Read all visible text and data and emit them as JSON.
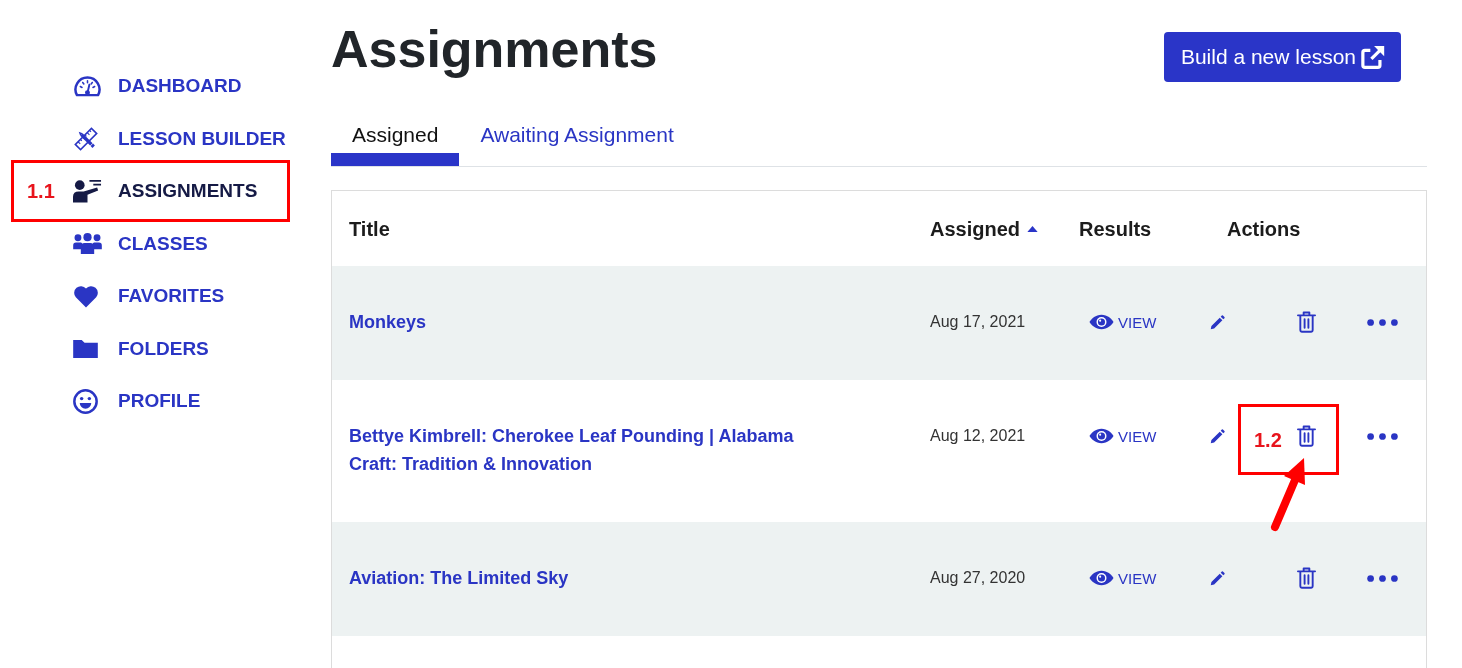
{
  "sidebar": {
    "items": [
      {
        "label": "DASHBOARD",
        "selected": false
      },
      {
        "label": "LESSON BUILDER",
        "selected": false
      },
      {
        "label": "ASSIGNMENTS",
        "selected": true,
        "annotation": {
          "label": "1.1"
        }
      },
      {
        "label": "CLASSES",
        "selected": false
      },
      {
        "label": "FAVORITES",
        "selected": false
      },
      {
        "label": "FOLDERS",
        "selected": false
      },
      {
        "label": "PROFILE",
        "selected": false
      }
    ]
  },
  "header": {
    "title": "Assignments",
    "button": "Build a new lesson"
  },
  "tabs": [
    {
      "label": "Assigned",
      "selected": true
    },
    {
      "label": "Awaiting Assignment",
      "selected": false
    }
  ],
  "table": {
    "columns": [
      {
        "label": "Title"
      },
      {
        "label": "Assigned",
        "sorted": true
      },
      {
        "label": "Results"
      },
      {
        "label": "Actions"
      }
    ],
    "rows": [
      {
        "title": "Monkeys",
        "assigned": "Aug 17, 2021",
        "results": "VIEW"
      },
      {
        "title": "Bettye Kimbrell: Cherokee Leaf Pounding | Alabama Craft: Tradition & Innovation",
        "assigned": "Aug 12, 2021",
        "results": "VIEW",
        "annotation": {
          "label": "1.2",
          "arrow": true
        }
      },
      {
        "title": "Aviation: The Limited Sky",
        "assigned": "Aug 27, 2020",
        "results": "VIEW"
      }
    ]
  }
}
